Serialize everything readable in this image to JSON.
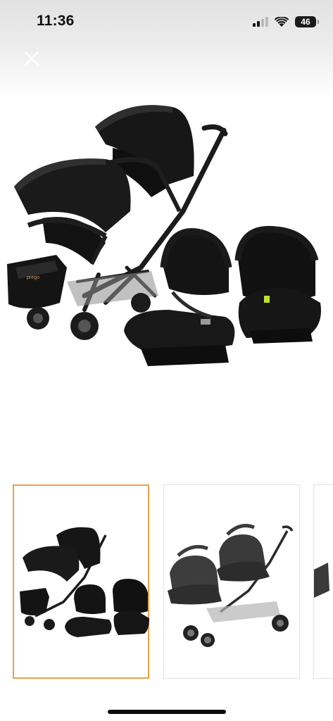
{
  "status_bar": {
    "time": "11:36",
    "battery_level": "46",
    "icons": [
      "cellular-signal-icon",
      "wifi-icon",
      "battery-icon"
    ]
  },
  "close_button": {
    "icon": "close-icon"
  },
  "colors": {
    "selected_thumbnail_border": "#e8a24a",
    "thumbnail_border": "#e3e3e3"
  },
  "gallery": {
    "thumbnails": [
      {
        "selected": true
      },
      {
        "selected": false
      },
      {
        "selected": false
      }
    ]
  }
}
